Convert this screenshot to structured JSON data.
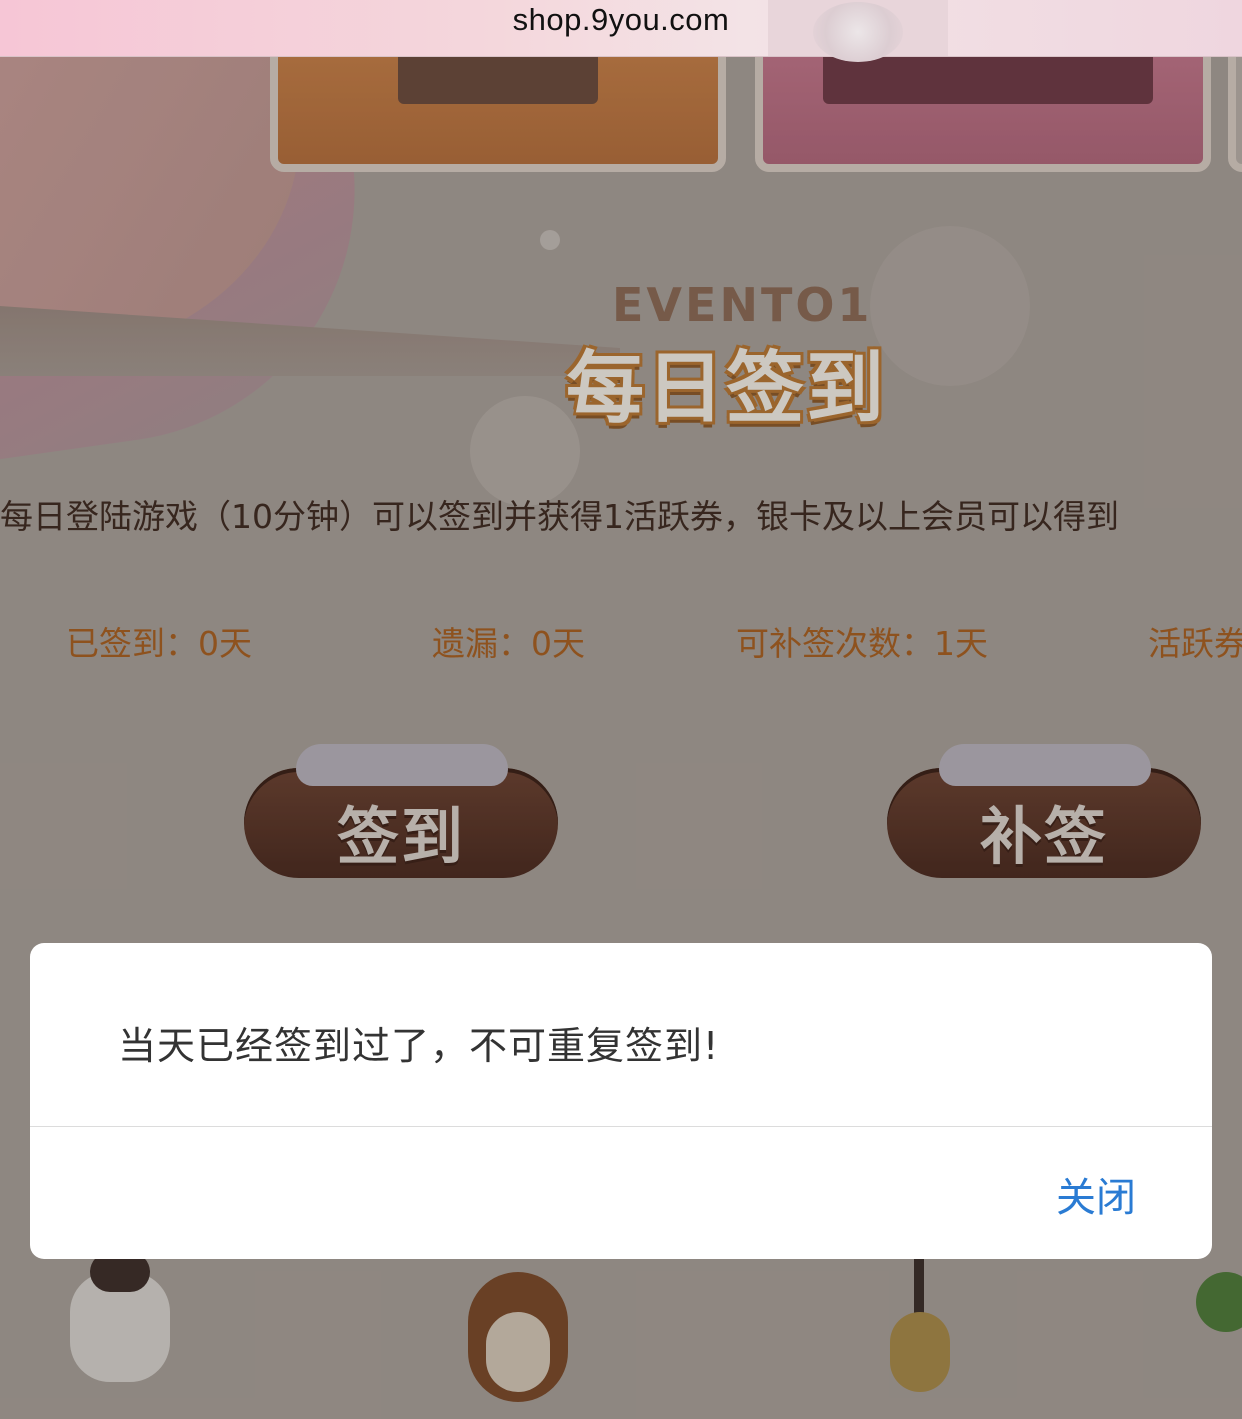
{
  "browser": {
    "url": "shop.9you.com"
  },
  "banner": {
    "event_tag": "EVENTO1",
    "event_title": "每日签到"
  },
  "main": {
    "description": "每日登陆游戏（10分钟）可以签到并获得1活跃券，银卡及以上会员可以得到",
    "stats": {
      "signed": "已签到：0天",
      "missed": "遗漏：0天",
      "makeup_count": "可补签次数：1天",
      "active": "活跃券"
    },
    "buttons": {
      "sign_in": "签到",
      "makeup": "补签"
    }
  },
  "dialog": {
    "message": "当天已经签到过了，不可重复签到!",
    "close_label": "关闭"
  },
  "colors": {
    "dialog_link": "#2a7bd3",
    "stat_text": "#a86022",
    "button_bg": "#4a2a20"
  }
}
